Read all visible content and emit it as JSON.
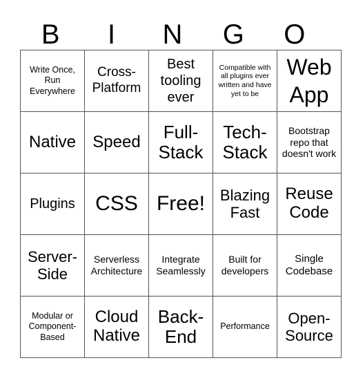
{
  "header": {
    "letters": [
      "B",
      "I",
      "N",
      "G",
      "O"
    ]
  },
  "board": {
    "rows": [
      [
        "Write Once, Run Everywhere",
        "Cross-Platform",
        "Best tooling ever",
        "Compatible with all plugins ever written and have yet to be",
        "Web App"
      ],
      [
        "Native",
        "Speed",
        "Full-Stack",
        "Tech-Stack",
        "Bootstrap repo that doesn't work"
      ],
      [
        "Plugins",
        "CSS",
        "Free!",
        "Blazing Fast",
        "Reuse Code"
      ],
      [
        "Server-Side",
        "Serverless Architecture",
        "Integrate Seamlessly",
        "Built for developers",
        "Single Codebase"
      ],
      [
        "Modular or Component-Based",
        "Cloud Native",
        "Back-End",
        "Performance",
        "Open-Source"
      ]
    ]
  }
}
